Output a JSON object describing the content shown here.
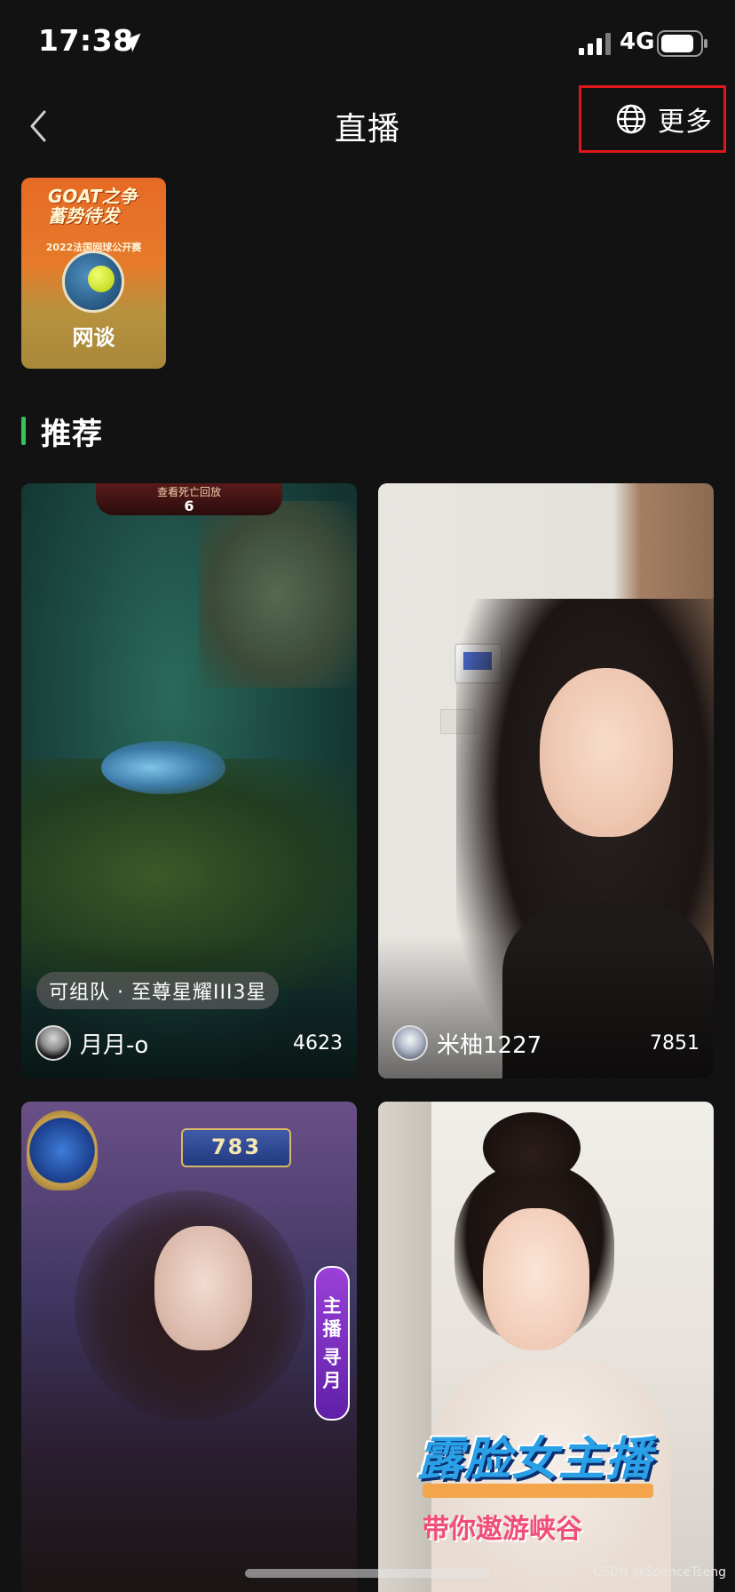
{
  "status_bar": {
    "time": "17:38",
    "network": "4G",
    "icons": [
      "location-arrow-icon",
      "cellular-signal-icon",
      "battery-icon"
    ]
  },
  "nav": {
    "title": "直播",
    "more_label": "更多",
    "icons": [
      "back-chevron-icon",
      "globe-icon"
    ],
    "highlight_color": "#e0161b"
  },
  "categories": [
    {
      "label": "网谈",
      "banner_title": "GOAT之争\n蓄势待发",
      "banner_subtitle": "2022法国网球公开赛"
    }
  ],
  "section": {
    "title": "推荐",
    "accent_color": "#35c35a"
  },
  "cards": [
    {
      "scene_text": "查看死亡回放",
      "scene_number": "6",
      "tag": "可组队 · 至尊星耀III3星",
      "streamer": "月月-o",
      "viewers": "4623"
    },
    {
      "streamer": "米柚1227",
      "viewers": "7851"
    },
    {
      "level": "783",
      "vertical_tag": [
        "主",
        "播",
        "寻",
        "月"
      ]
    },
    {
      "title": "露脸女主播",
      "subtitle": "带你遨游峡谷"
    }
  ],
  "watermark": "CSDN @SpenceTseng"
}
